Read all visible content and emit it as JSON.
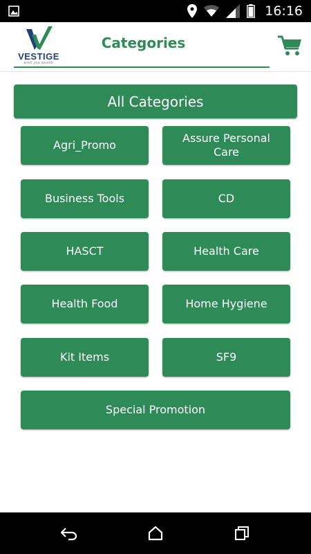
{
  "status_bar": {
    "time": "16:16"
  },
  "header": {
    "logo_text": "VESTIGE",
    "logo_tagline": "wish you wealth",
    "title": "Categories"
  },
  "all_categories_label": "All Categories",
  "categories": [
    "Agri_Promo",
    "Assure Personal Care",
    "Business Tools",
    "CD",
    "HASCT",
    "Health Care",
    "Health Food",
    "Home Hygiene",
    "Kit Items",
    "SF9",
    "Special Promotion"
  ],
  "colors": {
    "primary_green": "#2e8b57",
    "logo_blue": "#1f3f7a",
    "status_bar": "#000000",
    "nav_bar": "#000000"
  },
  "icons": {
    "status": [
      "gallery-icon",
      "location-icon",
      "wifi-icon",
      "signal-icon",
      "battery-icon"
    ],
    "header": [
      "cart-icon"
    ],
    "nav": [
      "back-icon",
      "home-icon",
      "recents-icon"
    ]
  }
}
